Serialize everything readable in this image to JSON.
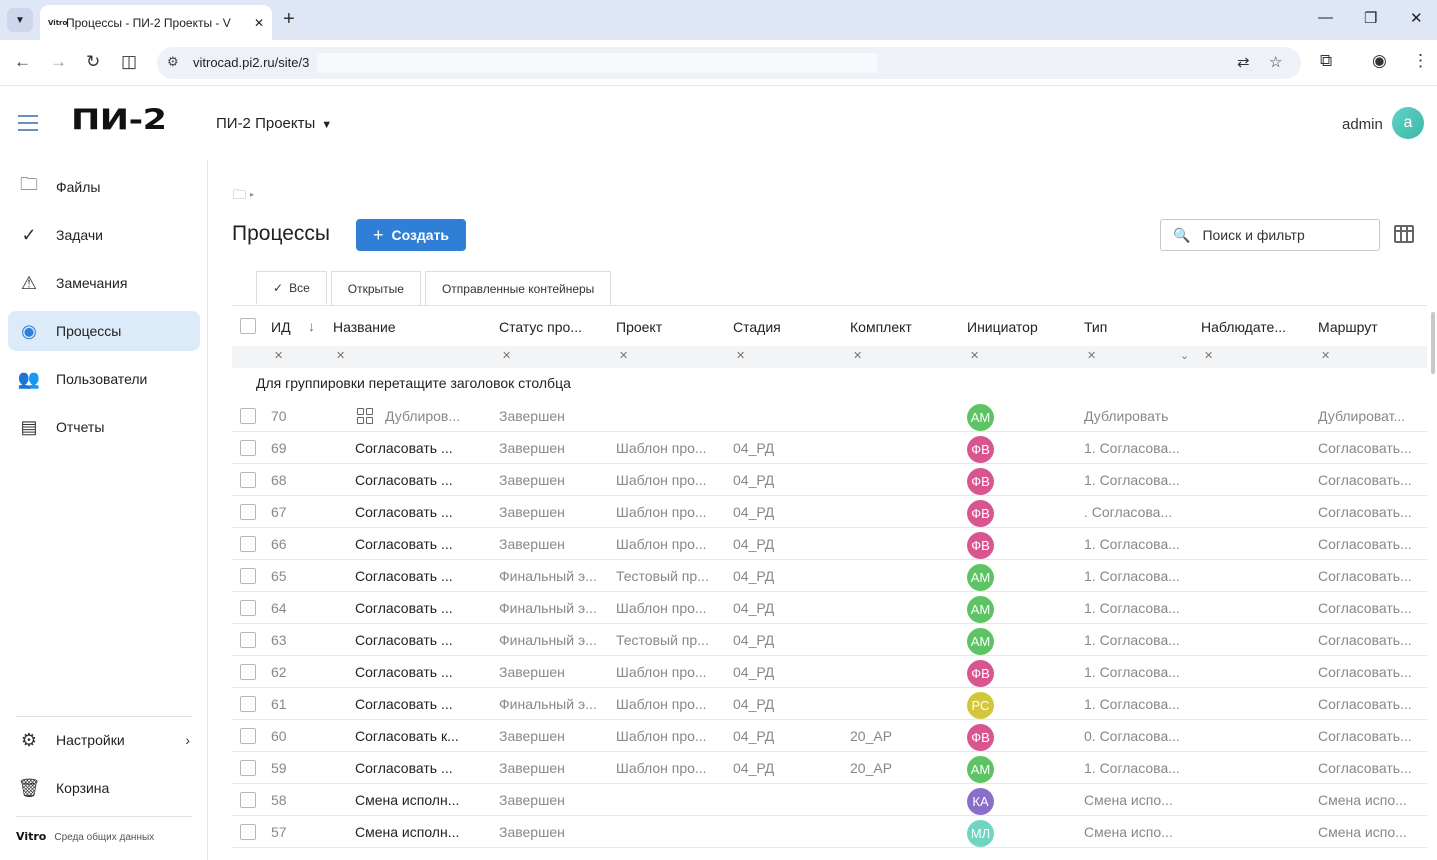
{
  "browser": {
    "tab_favicon": "Vitro",
    "tab_title": "Процессы - ПИ-2 Проекты - V",
    "url": "vitrocad.pi2.ru/site/3"
  },
  "header": {
    "logo": "ПИ-2",
    "project": "ПИ-2 Проекты",
    "user": "admin",
    "avatar": "a"
  },
  "sidebar": {
    "items": [
      {
        "label": "Файлы",
        "icon": "folder-icon"
      },
      {
        "label": "Задачи",
        "icon": "check-circle-icon"
      },
      {
        "label": "Замечания",
        "icon": "warning-icon"
      },
      {
        "label": "Процессы",
        "icon": "process-icon"
      },
      {
        "label": "Пользователи",
        "icon": "users-icon"
      },
      {
        "label": "Отчеты",
        "icon": "report-icon"
      }
    ],
    "settings": "Настройки",
    "trash": "Корзина",
    "footer_brand": "Vitro",
    "footer_text": "Среда общих данных"
  },
  "main": {
    "title": "Процессы",
    "create": "Создать",
    "search_placeholder": "Поиск и фильтр",
    "tabs": [
      "Все",
      "Открытые",
      "Отправленные контейнеры"
    ],
    "columns": [
      "ИД",
      "Название",
      "Статус про...",
      "Проект",
      "Стадия",
      "Комплект",
      "Инициатор",
      "Тип",
      "Наблюдате...",
      "Маршрут"
    ],
    "group_hint": "Для группировки перетащите заголовок столбца",
    "rows": [
      {
        "id": "70",
        "name": "Дублиров...",
        "status": "Завершен",
        "project": "",
        "stage": "",
        "kit": "",
        "initials": "АМ",
        "color": "#5cc463",
        "type": "Дублировать",
        "route": "Дублироват..."
      },
      {
        "id": "69",
        "name": "Согласовать ...",
        "status": "Завершен",
        "project": "Шаблон про...",
        "stage": "04_РД",
        "kit": "",
        "initials": "ФВ",
        "color": "#d9558f",
        "type": "1. Согласова...",
        "route": "Согласовать..."
      },
      {
        "id": "68",
        "name": "Согласовать ...",
        "status": "Завершен",
        "project": "Шаблон про...",
        "stage": "04_РД",
        "kit": "",
        "initials": "ФВ",
        "color": "#d9558f",
        "type": "1. Согласова...",
        "route": "Согласовать..."
      },
      {
        "id": "67",
        "name": "Согласовать ...",
        "status": "Завершен",
        "project": "Шаблон про...",
        "stage": "04_РД",
        "kit": "",
        "initials": "ФВ",
        "color": "#d9558f",
        "type": ". Согласова...",
        "route": "Согласовать..."
      },
      {
        "id": "66",
        "name": "Согласовать ...",
        "status": "Завершен",
        "project": "Шаблон про...",
        "stage": "04_РД",
        "kit": "",
        "initials": "ФВ",
        "color": "#d9558f",
        "type": "1. Согласова...",
        "route": "Согласовать..."
      },
      {
        "id": "65",
        "name": "Согласовать ...",
        "status": "Финальный э...",
        "project": "Тестовый пр...",
        "stage": "04_РД",
        "kit": "",
        "initials": "АМ",
        "color": "#5cc463",
        "type": "1. Согласова...",
        "route": "Согласовать..."
      },
      {
        "id": "64",
        "name": "Согласовать ...",
        "status": "Финальный э...",
        "project": "Шаблон про...",
        "stage": "04_РД",
        "kit": "",
        "initials": "АМ",
        "color": "#5cc463",
        "type": "1. Согласова...",
        "route": "Согласовать..."
      },
      {
        "id": "63",
        "name": "Согласовать ...",
        "status": "Финальный э...",
        "project": "Тестовый пр...",
        "stage": "04_РД",
        "kit": "",
        "initials": "АМ",
        "color": "#5cc463",
        "type": "1. Согласова...",
        "route": "Согласовать..."
      },
      {
        "id": "62",
        "name": "Согласовать ...",
        "status": "Завершен",
        "project": "Шаблон про...",
        "stage": "04_РД",
        "kit": "",
        "initials": "ФВ",
        "color": "#d9558f",
        "type": "1. Согласова...",
        "route": "Согласовать..."
      },
      {
        "id": "61",
        "name": "Согласовать ...",
        "status": "Финальный э...",
        "project": "Шаблон про...",
        "stage": "04_РД",
        "kit": "",
        "initials": "РС",
        "color": "#d2c63a",
        "type": "1. Согласова...",
        "route": "Согласовать..."
      },
      {
        "id": "60",
        "name": "Согласовать к...",
        "status": "Завершен",
        "project": "Шаблон про...",
        "stage": "04_РД",
        "kit": "20_АР",
        "initials": "ФВ",
        "color": "#d9558f",
        "type": "0. Согласова...",
        "route": "Согласовать..."
      },
      {
        "id": "59",
        "name": "Согласовать ...",
        "status": "Завершен",
        "project": "Шаблон про...",
        "stage": "04_РД",
        "kit": "20_АР",
        "initials": "АМ",
        "color": "#5cc463",
        "type": "1. Согласова...",
        "route": "Согласовать..."
      },
      {
        "id": "58",
        "name": "Смена исполн...",
        "status": "Завершен",
        "project": "",
        "stage": "",
        "kit": "",
        "initials": "КА",
        "color": "#8a6fc9",
        "type": "Смена испо...",
        "route": "Смена испо..."
      },
      {
        "id": "57",
        "name": "Смена исполн...",
        "status": "Завершен",
        "project": "",
        "stage": "",
        "kit": "",
        "initials": "МЛ",
        "color": "#6fd4c0",
        "type": "Смена испо...",
        "route": "Смена испо..."
      }
    ]
  }
}
